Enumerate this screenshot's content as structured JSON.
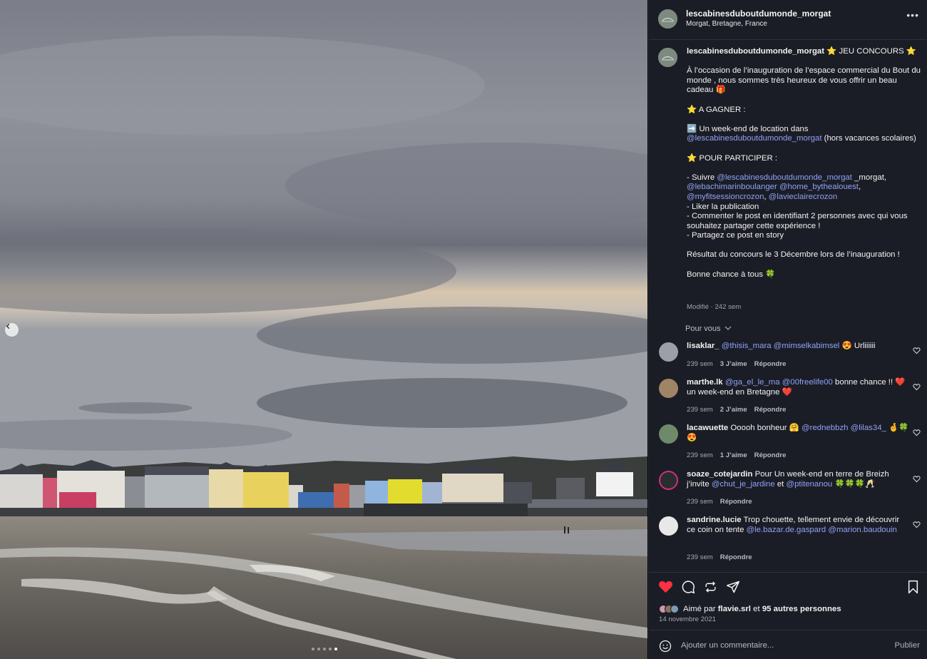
{
  "post": {
    "username": "lescabinesduboutdumonde_morgat",
    "location": "Morgat, Bretagne, France",
    "more_icon": "more-horizontal-icon"
  },
  "caption": {
    "username": "lescabinesduboutdumonde_morgat",
    "title": " ⭐️ JEU CONCOURS ⭐️",
    "intro": "À l’occasion de l’inauguration de l’espace commercial du Bout du monde , nous sommes très heureux de vous offrir un beau cadeau 🎁",
    "gagner_heading": "⭐️ A GAGNER :",
    "prize_prefix": "➡️ Un week-end de location dans ",
    "prize_mention": "@lescabinesduboutdumonde_morgat",
    "prize_suffix": " (hors vacances scolaires)",
    "participer_heading": "⭐️ POUR PARTICIPER :",
    "follow_prefix": "- Suivre ",
    "follow_mention1": "@lescabinesduboutdumonde_morgat",
    "follow_text1": " _morgat, ",
    "follow_mention2": "@lebachimarinboulanger",
    "follow_text2": " ",
    "follow_mention3": "@home_bythealouest",
    "follow_text3": ", ",
    "follow_mention4": "@myfitsessioncrozon",
    "follow_text4": ", ",
    "follow_mention5": "@lavieclairecrozon",
    "rule_like": "- Liker la publication",
    "rule_comment": "- Commenter le post en identifiant 2 personnes avec qui vous souhaitez partager cette expérience !",
    "rule_share": "- Partagez ce post en story",
    "result": "Résultat du concours le 3 Décembre lors de l’inauguration !",
    "luck": "Bonne chance à tous 🍀",
    "meta": "Modifié · 242 sem"
  },
  "filter_label": "Pour vous",
  "comments": [
    {
      "user": "lisaklar_",
      "parts": [
        {
          "t": " ",
          "m": false
        },
        {
          "t": "@thisis_mara",
          "m": true
        },
        {
          "t": " ",
          "m": false
        },
        {
          "t": "@mimselkabimsel",
          "m": true
        },
        {
          "t": " 😍 Urliiiiii",
          "m": false
        }
      ],
      "time": "239 sem",
      "likes": "3 J’aime",
      "reply": "Répondre"
    },
    {
      "user": "marthe.lk",
      "parts": [
        {
          "t": " ",
          "m": false
        },
        {
          "t": "@ga_el_le_ma",
          "m": true
        },
        {
          "t": " ",
          "m": false
        },
        {
          "t": "@00freelife00",
          "m": true
        },
        {
          "t": " bonne chance !! ❤️ un week-end en Bretagne ❤️",
          "m": false
        }
      ],
      "time": "239 sem",
      "likes": "2 J’aime",
      "reply": "Répondre"
    },
    {
      "user": "lacawuette",
      "parts": [
        {
          "t": " Ooooh bonheur 🤗 ",
          "m": false
        },
        {
          "t": "@rednebbzh",
          "m": true
        },
        {
          "t": " ",
          "m": false
        },
        {
          "t": "@lilas34_",
          "m": true
        },
        {
          "t": " 🤞🍀😍",
          "m": false
        }
      ],
      "time": "239 sem",
      "likes": "1 J’aime",
      "reply": "Répondre"
    },
    {
      "user": "soaze_cotejardin",
      "parts": [
        {
          "t": " Pour Un week-end en terre de Breizh j’invite ",
          "m": false
        },
        {
          "t": "@chut_je_jardine",
          "m": true
        },
        {
          "t": " et ",
          "m": false
        },
        {
          "t": "@ptitenanou",
          "m": true
        },
        {
          "t": " 🍀🍀🍀🥂",
          "m": false
        }
      ],
      "time": "239 sem",
      "likes": "",
      "reply": "Répondre"
    },
    {
      "user": "sandrine.lucie",
      "parts": [
        {
          "t": " Trop chouette, tellement envie de découvrir ce coin on tente ",
          "m": false
        },
        {
          "t": "@le.bazar.de.gaspard",
          "m": true
        },
        {
          "t": " ",
          "m": false
        },
        {
          "t": "@marion.baudouin",
          "m": true
        }
      ],
      "time": "239 sem",
      "likes": "",
      "reply": "Répondre"
    }
  ],
  "actions": {
    "liked_prefix": "Aimé par ",
    "liked_user": "flavie.srl",
    "liked_mid": " et ",
    "liked_others": "95 autres personnes",
    "date": "14 novembre 2021",
    "comment_placeholder": "Ajouter un commentaire...",
    "publish": "Publier",
    "like_color": "#ff3040"
  },
  "carousel": {
    "count": 5,
    "active": 5
  }
}
